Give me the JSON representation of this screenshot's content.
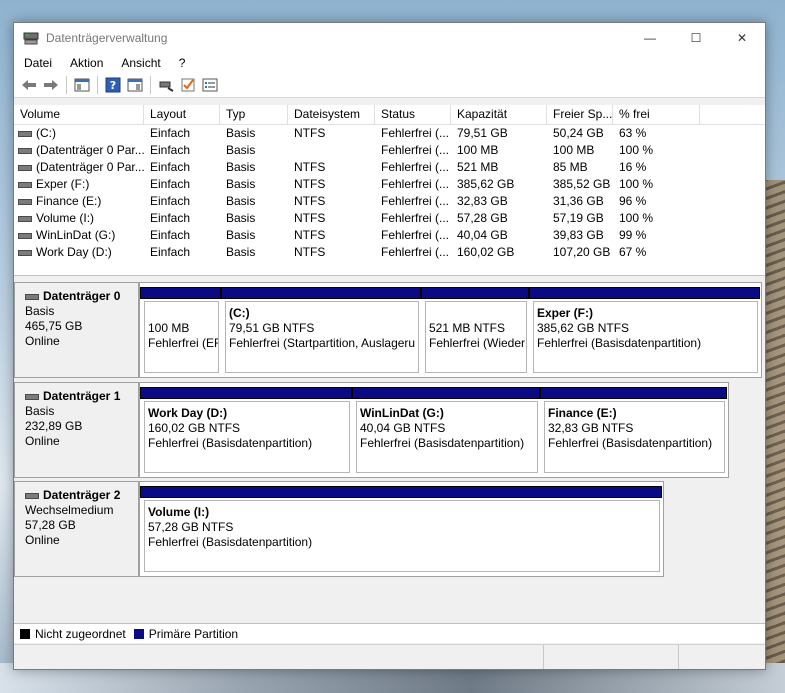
{
  "window": {
    "title": "Datenträgerverwaltung",
    "controls": {
      "minimize": "—",
      "maximize": "☐",
      "close": "✕"
    }
  },
  "menu": [
    "Datei",
    "Aktion",
    "Ansicht",
    "?"
  ],
  "toolbar": [
    "back-arrow-icon",
    "forward-arrow-icon",
    "console-tree-icon",
    "help-icon",
    "properties-icon",
    "rescan-icon",
    "check-icon",
    "settings-list-icon"
  ],
  "columns": [
    "Volume",
    "Layout",
    "Typ",
    "Dateisystem",
    "Status",
    "Kapazität",
    "Freier Sp...",
    "% frei"
  ],
  "volumes": [
    [
      "(C:)",
      "Einfach",
      "Basis",
      "NTFS",
      "Fehlerfrei (...",
      "79,51 GB",
      "50,24 GB",
      "63 %"
    ],
    [
      "(Datenträger 0 Par...",
      "Einfach",
      "Basis",
      "",
      "Fehlerfrei (...",
      "100 MB",
      "100 MB",
      "100 %"
    ],
    [
      "(Datenträger 0 Par...",
      "Einfach",
      "Basis",
      "NTFS",
      "Fehlerfrei (...",
      "521 MB",
      "85 MB",
      "16 %"
    ],
    [
      "Exper (F:)",
      "Einfach",
      "Basis",
      "NTFS",
      "Fehlerfrei (...",
      "385,62 GB",
      "385,52 GB",
      "100 %"
    ],
    [
      "Finance (E:)",
      "Einfach",
      "Basis",
      "NTFS",
      "Fehlerfrei (...",
      "32,83 GB",
      "31,36 GB",
      "96 %"
    ],
    [
      "Volume (I:)",
      "Einfach",
      "Basis",
      "NTFS",
      "Fehlerfrei (...",
      "57,28 GB",
      "57,19 GB",
      "100 %"
    ],
    [
      "WinLinDat (G:)",
      "Einfach",
      "Basis",
      "NTFS",
      "Fehlerfrei (...",
      "40,04 GB",
      "39,83 GB",
      "99 %"
    ],
    [
      "Work Day (D:)",
      "Einfach",
      "Basis",
      "NTFS",
      "Fehlerfrei (...",
      "160,02 GB",
      "107,20 GB",
      "67 %"
    ]
  ],
  "disks": [
    {
      "name": "Datenträger 0",
      "type": "Basis",
      "size": "465,75 GB",
      "status": "Online",
      "partitions": [
        {
          "name": "",
          "size": "100 MB",
          "status": "Fehlerfrei (EF"
        },
        {
          "name": "(C:)",
          "size": "79,51 GB NTFS",
          "status": "Fehlerfrei (Startpartition, Auslageru"
        },
        {
          "name": "",
          "size": "521 MB NTFS",
          "status": "Fehlerfrei (Wieder"
        },
        {
          "name": "Exper  (F:)",
          "size": "385,62 GB NTFS",
          "status": "Fehlerfrei (Basisdatenpartition)"
        }
      ]
    },
    {
      "name": "Datenträger 1",
      "type": "Basis",
      "size": "232,89 GB",
      "status": "Online",
      "partitions": [
        {
          "name": "Work Day  (D:)",
          "size": "160,02 GB NTFS",
          "status": "Fehlerfrei (Basisdatenpartition)"
        },
        {
          "name": "WinLinDat  (G:)",
          "size": "40,04 GB NTFS",
          "status": "Fehlerfrei (Basisdatenpartition)"
        },
        {
          "name": "Finance  (E:)",
          "size": "32,83 GB NTFS",
          "status": "Fehlerfrei (Basisdatenpartition)"
        }
      ]
    },
    {
      "name": "Datenträger 2",
      "type": "Wechselmedium",
      "size": "57,28 GB",
      "status": "Online",
      "partitions": [
        {
          "name": "Volume  (I:)",
          "size": "57,28 GB NTFS",
          "status": "Fehlerfrei (Basisdatenpartition)"
        }
      ]
    }
  ],
  "legend": {
    "unallocated": "Nicht zugeordnet",
    "primary": "Primäre Partition",
    "unallocated_color": "#000000",
    "primary_color": "#0a0a84"
  }
}
